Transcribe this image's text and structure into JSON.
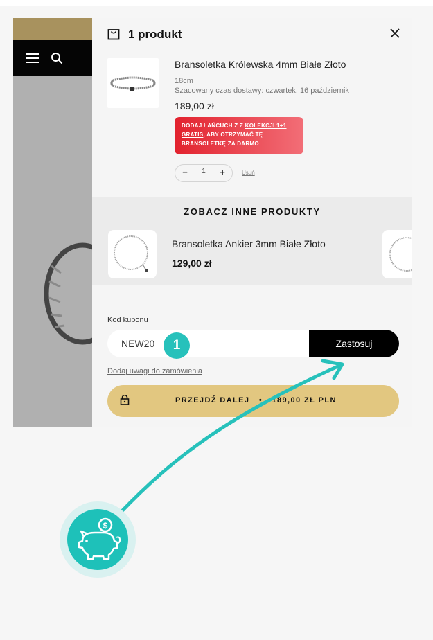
{
  "cart": {
    "title": "1 produkt",
    "item": {
      "name": "Bransoletka Królewska 4mm Białe Złoto",
      "size": "18cm",
      "delivery": "Szacowany czas dostawy: czwartek, 16 październik",
      "price": "189,00 zł",
      "quantity": "1",
      "remove_label": "Usuń"
    },
    "promo": {
      "line1_prefix": "DODAJ ŁAŃCUCH Z Z",
      "link1": "KOLEKCJI 1+1",
      "link2": "GRATIS",
      "line2_suffix": ", ABY OTRZYMAĆ TĘ",
      "line3": "BRANSOLETKĘ ZA DARMO"
    },
    "related": {
      "title": "ZOBACZ INNE PRODUKTY",
      "items": [
        {
          "name": "Bransoletka Ankier 3mm Białe Złoto",
          "price": "129,00 zł"
        }
      ]
    },
    "coupon": {
      "label": "Kod kuponu",
      "value": "NEW20",
      "apply_label": "Zastosuj"
    },
    "notes_link": "Dodaj uwagi do zamówienia",
    "checkout": {
      "label": "PRZEJDŹ DALEJ",
      "separator": "•",
      "price": "189,00 ZŁ PLN"
    }
  },
  "annotation": {
    "step_number": "1",
    "accent_color": "#27c1bb",
    "badge_icon": "piggy-bank-icon"
  },
  "colors": {
    "promo_red": "#e2222e",
    "checkout_gold": "#e2c780",
    "apply_black": "#000000"
  }
}
